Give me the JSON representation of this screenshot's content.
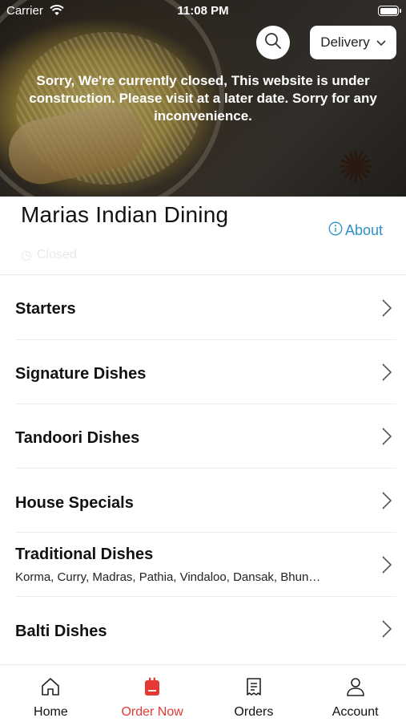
{
  "status_bar": {
    "carrier": "Carrier",
    "time": "11:08 PM"
  },
  "header": {
    "delivery_mode": "Delivery",
    "closed_message": "Sorry, We're currently closed, This website is under construction. Please visit at a later date. Sorry for any inconvenience."
  },
  "restaurant": {
    "name": "Marias Indian Dining",
    "about_label": "About",
    "status": "Closed"
  },
  "menu": {
    "categories": [
      {
        "name": "Starters",
        "description": ""
      },
      {
        "name": "Signature Dishes",
        "description": ""
      },
      {
        "name": "Tandoori Dishes",
        "description": ""
      },
      {
        "name": "House Specials",
        "description": ""
      },
      {
        "name": "Traditional Dishes",
        "description": "Korma, Curry, Madras, Pathia, Vindaloo, Dansak, Bhun…"
      },
      {
        "name": "Balti Dishes",
        "description": ""
      }
    ]
  },
  "bottom_nav": {
    "items": [
      {
        "label": "Home",
        "icon": "home-icon"
      },
      {
        "label": "Order Now",
        "icon": "order-bag-icon",
        "active": true
      },
      {
        "label": "Orders",
        "icon": "receipt-icon"
      },
      {
        "label": "Account",
        "icon": "account-icon"
      }
    ]
  },
  "colors": {
    "accent_active": "#e53935",
    "link": "#2f8fc9"
  }
}
